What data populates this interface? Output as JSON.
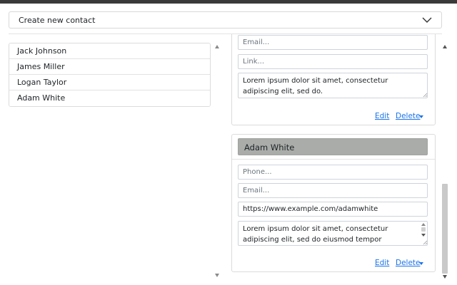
{
  "create_contact": {
    "label": "Create new contact"
  },
  "contacts": [
    {
      "name": "Jack Johnson"
    },
    {
      "name": "James Miller"
    },
    {
      "name": "Logan Taylor"
    },
    {
      "name": "Adam White"
    }
  ],
  "cards": [
    {
      "email_placeholder": "Email...",
      "link_placeholder": "Link...",
      "notes": "Lorem ipsum dolor sit amet, consectetur adipiscing elit, sed do.",
      "edit_label": "Edit",
      "delete_label": "Delete"
    },
    {
      "name": "Adam White",
      "phone_placeholder": "Phone...",
      "email_placeholder": "Email...",
      "link_value": "https://www.example.com/adamwhite",
      "notes": "Lorem ipsum dolor sit amet, consectetur adipiscing elit, sed do eiusmod tempor incididunt ut labore et dolore magna aliqua.",
      "edit_label": "Edit",
      "delete_label": "Delete"
    }
  ]
}
